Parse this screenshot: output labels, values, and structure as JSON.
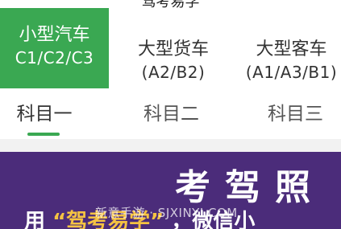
{
  "header": {
    "title": "驾考易学"
  },
  "vehicle_tabs": [
    {
      "name": "小型汽车",
      "license": "C1/C2/C3"
    },
    {
      "name": "大型货车",
      "license": "(A2/B2)"
    },
    {
      "name": "大型客车",
      "license": "(A1/A3/B1)"
    }
  ],
  "subject_tabs": [
    "科目一",
    "科目二",
    "科目三"
  ],
  "banner": {
    "headline": "考驾照",
    "sub_prefix": "用",
    "sub_highlight": "“驾考易学”",
    "sub_suffix": "，微信小"
  },
  "watermark": "新意手游 · SJXINYI.COM",
  "colors": {
    "accent": "#3aa852",
    "banner_bg": "#4b2c7a",
    "highlight": "#f5c342"
  }
}
